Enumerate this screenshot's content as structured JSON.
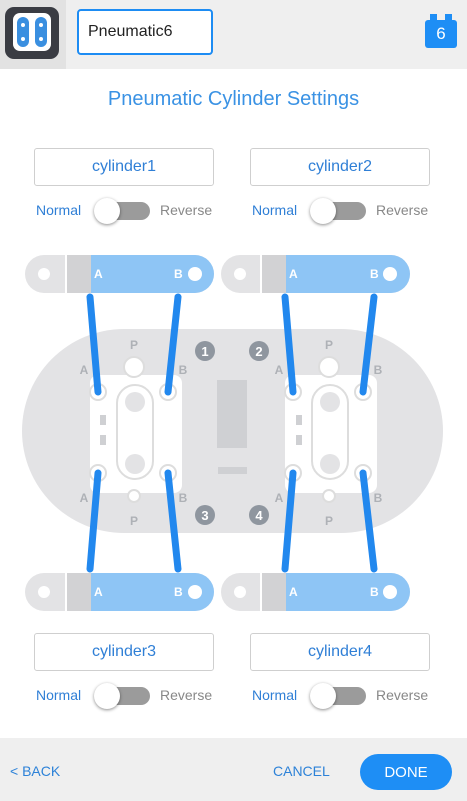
{
  "header": {
    "device_icon": "pneumatic-device-icon",
    "name_value": "Pneumatic6",
    "port_number": "6"
  },
  "page_title": "Pneumatic Cylinder Settings",
  "cylinders": [
    {
      "name": "cylinder1",
      "normal_label": "Normal",
      "reverse_label": "Reverse"
    },
    {
      "name": "cylinder2",
      "normal_label": "Normal",
      "reverse_label": "Reverse"
    },
    {
      "name": "cylinder3",
      "normal_label": "Normal",
      "reverse_label": "Reverse"
    },
    {
      "name": "cylinder4",
      "normal_label": "Normal",
      "reverse_label": "Reverse"
    }
  ],
  "diagram": {
    "cylinder_port_a": "A",
    "cylinder_port_b": "B",
    "valve_port_a": "A",
    "valve_port_b": "B",
    "valve_port_p": "P",
    "port_numbers": [
      "1",
      "2",
      "3",
      "4"
    ]
  },
  "footer": {
    "back_label": "< BACK",
    "cancel_label": "CANCEL",
    "done_label": "DONE"
  },
  "colors": {
    "accent": "#1e8ef5",
    "tube": "#2288ee",
    "cylinder_highlight": "#8ec5f5",
    "diagram_gray": "#e3e3e5",
    "number_badge": "#8f969f"
  }
}
